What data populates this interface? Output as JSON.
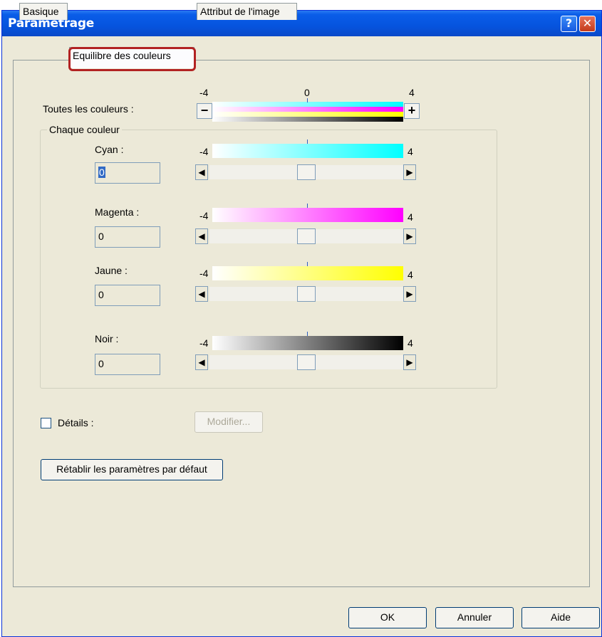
{
  "window": {
    "title": "Paramétrage",
    "help_label": "?",
    "close_label": "✕"
  },
  "tabs": [
    {
      "label": "Basique",
      "active": false
    },
    {
      "label": "Equilibre des couleurs",
      "active": true
    },
    {
      "label": "Attribut de l'image",
      "active": false
    }
  ],
  "all_colors": {
    "label": "Toutes les couleurs :",
    "min_label": "-4",
    "zero_label": "0",
    "max_label": "4",
    "minus_label": "−",
    "plus_label": "+"
  },
  "each_color": {
    "group_title": "Chaque couleur",
    "channels": [
      {
        "label": "Cyan :",
        "value": "0",
        "min_label": "-4",
        "max_label": "4",
        "color": "#00FFFF",
        "level": 0.5
      },
      {
        "label": "Magenta :",
        "value": "0",
        "min_label": "-4",
        "max_label": "4",
        "color": "#FF00FF",
        "level": 0.5
      },
      {
        "label": "Jaune :",
        "value": "0",
        "min_label": "-4",
        "max_label": "4",
        "color": "#FFFF00",
        "level": 0.5
      },
      {
        "label": "Noir :",
        "value": "0",
        "min_label": "-4",
        "max_label": "4",
        "color": "#000000",
        "level": 0.5
      }
    ]
  },
  "details": {
    "checkbox_label": "Détails :",
    "checked": false,
    "modify_button": "Modifier..."
  },
  "reset_button": "Rétablir les paramètres par défaut",
  "footer": {
    "ok": "OK",
    "cancel": "Annuler",
    "help": "Aide"
  },
  "colors": {
    "titlebar": "#0654DE",
    "dialog_bg": "#ECE9D8",
    "highlight": "#B22222"
  }
}
